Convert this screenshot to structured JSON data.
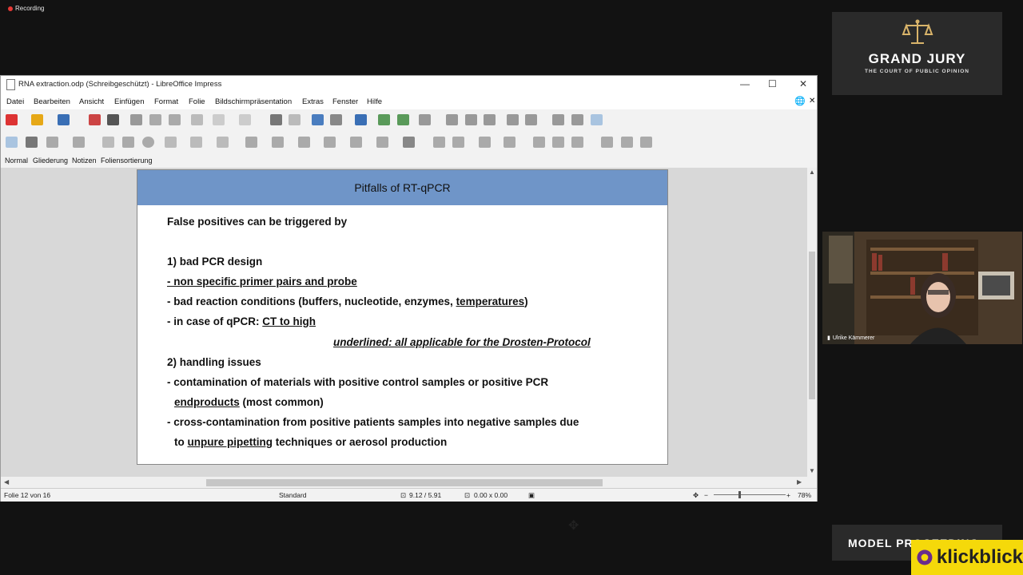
{
  "recording": {
    "label": "Recording"
  },
  "logo": {
    "title": "GRAND JURY",
    "subtitle": "THE COURT OF PUBLIC OPINION"
  },
  "webcam": {
    "name": "Ulrike Kämmerer"
  },
  "banner": {
    "label": "MODEL PROCEEDING"
  },
  "watermark": {
    "label": "klickblick"
  },
  "window": {
    "title": "RNA extraction.odp (Schreibgeschützt) - LibreOffice Impress",
    "menu": [
      "Datei",
      "Bearbeiten",
      "Ansicht",
      "Einfügen",
      "Format",
      "Folie",
      "Bildschirmpräsentation",
      "Extras",
      "Fenster",
      "Hilfe"
    ],
    "view_tabs": [
      "Normal",
      "Gliederung",
      "Notizen",
      "Foliensortierung"
    ]
  },
  "slide": {
    "title": "Pitfalls of RT-qPCR",
    "line1": "False positives can be triggered  by",
    "line2": "1) bad PCR design",
    "line3": "- non specific primer pairs and probe",
    "line4a": "- bad reaction conditions (buffers, nucleotide, enzymes, ",
    "line4b": "temperatures",
    "line4c": ")",
    "line5a": "- in case of qPCR: ",
    "line5b": "CT to high",
    "note": "underlined: all applicable for the Drosten-Protocol",
    "line6": "2) handling issues",
    "line7": "- contamination of materials with positive control samples or positive PCR",
    "line8a": "endproducts",
    "line8b": " (most common)",
    "line9": "- cross-contamination from positive patients samples into negative samples due",
    "line10a": "to ",
    "line10b": "unpure pipetting",
    "line10c": " techniques or aerosol production"
  },
  "status": {
    "slide": "Folie 12 von 16",
    "layout": "Standard",
    "position": "9.12 / 5.91",
    "size": "0.00 x 0.00",
    "zoom": "78%"
  }
}
